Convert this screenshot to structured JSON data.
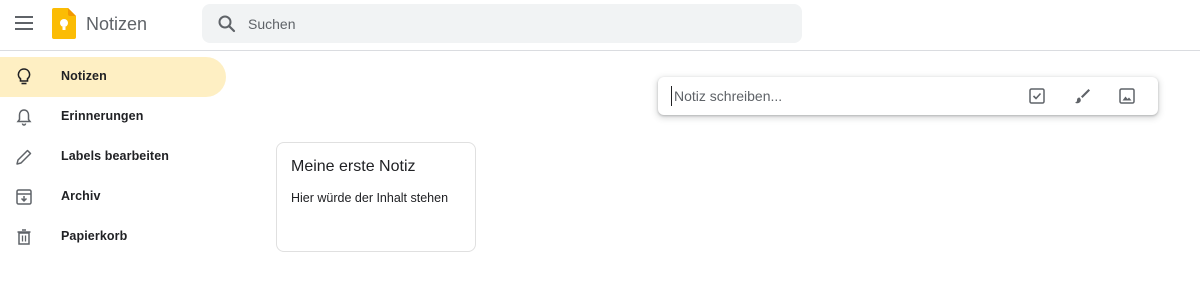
{
  "header": {
    "app_title": "Notizen",
    "search_placeholder": "Suchen",
    "logo_color": "#fbbc04"
  },
  "sidebar": {
    "items": [
      {
        "label": "Notizen",
        "icon": "lightbulb-icon",
        "active": true
      },
      {
        "label": "Erinnerungen",
        "icon": "bell-icon",
        "active": false
      },
      {
        "label": "Labels bearbeiten",
        "icon": "pencil-icon",
        "active": false
      },
      {
        "label": "Archiv",
        "icon": "archive-icon",
        "active": false
      },
      {
        "label": "Papierkorb",
        "icon": "trash-icon",
        "active": false
      }
    ],
    "active_color": "#feefc3"
  },
  "take_note": {
    "placeholder": "Notiz schreiben...",
    "actions": [
      "checkbox-icon",
      "brush-icon",
      "image-icon"
    ]
  },
  "notes": [
    {
      "title": "Meine erste Notiz",
      "body": "Hier würde der Inhalt stehen"
    }
  ]
}
